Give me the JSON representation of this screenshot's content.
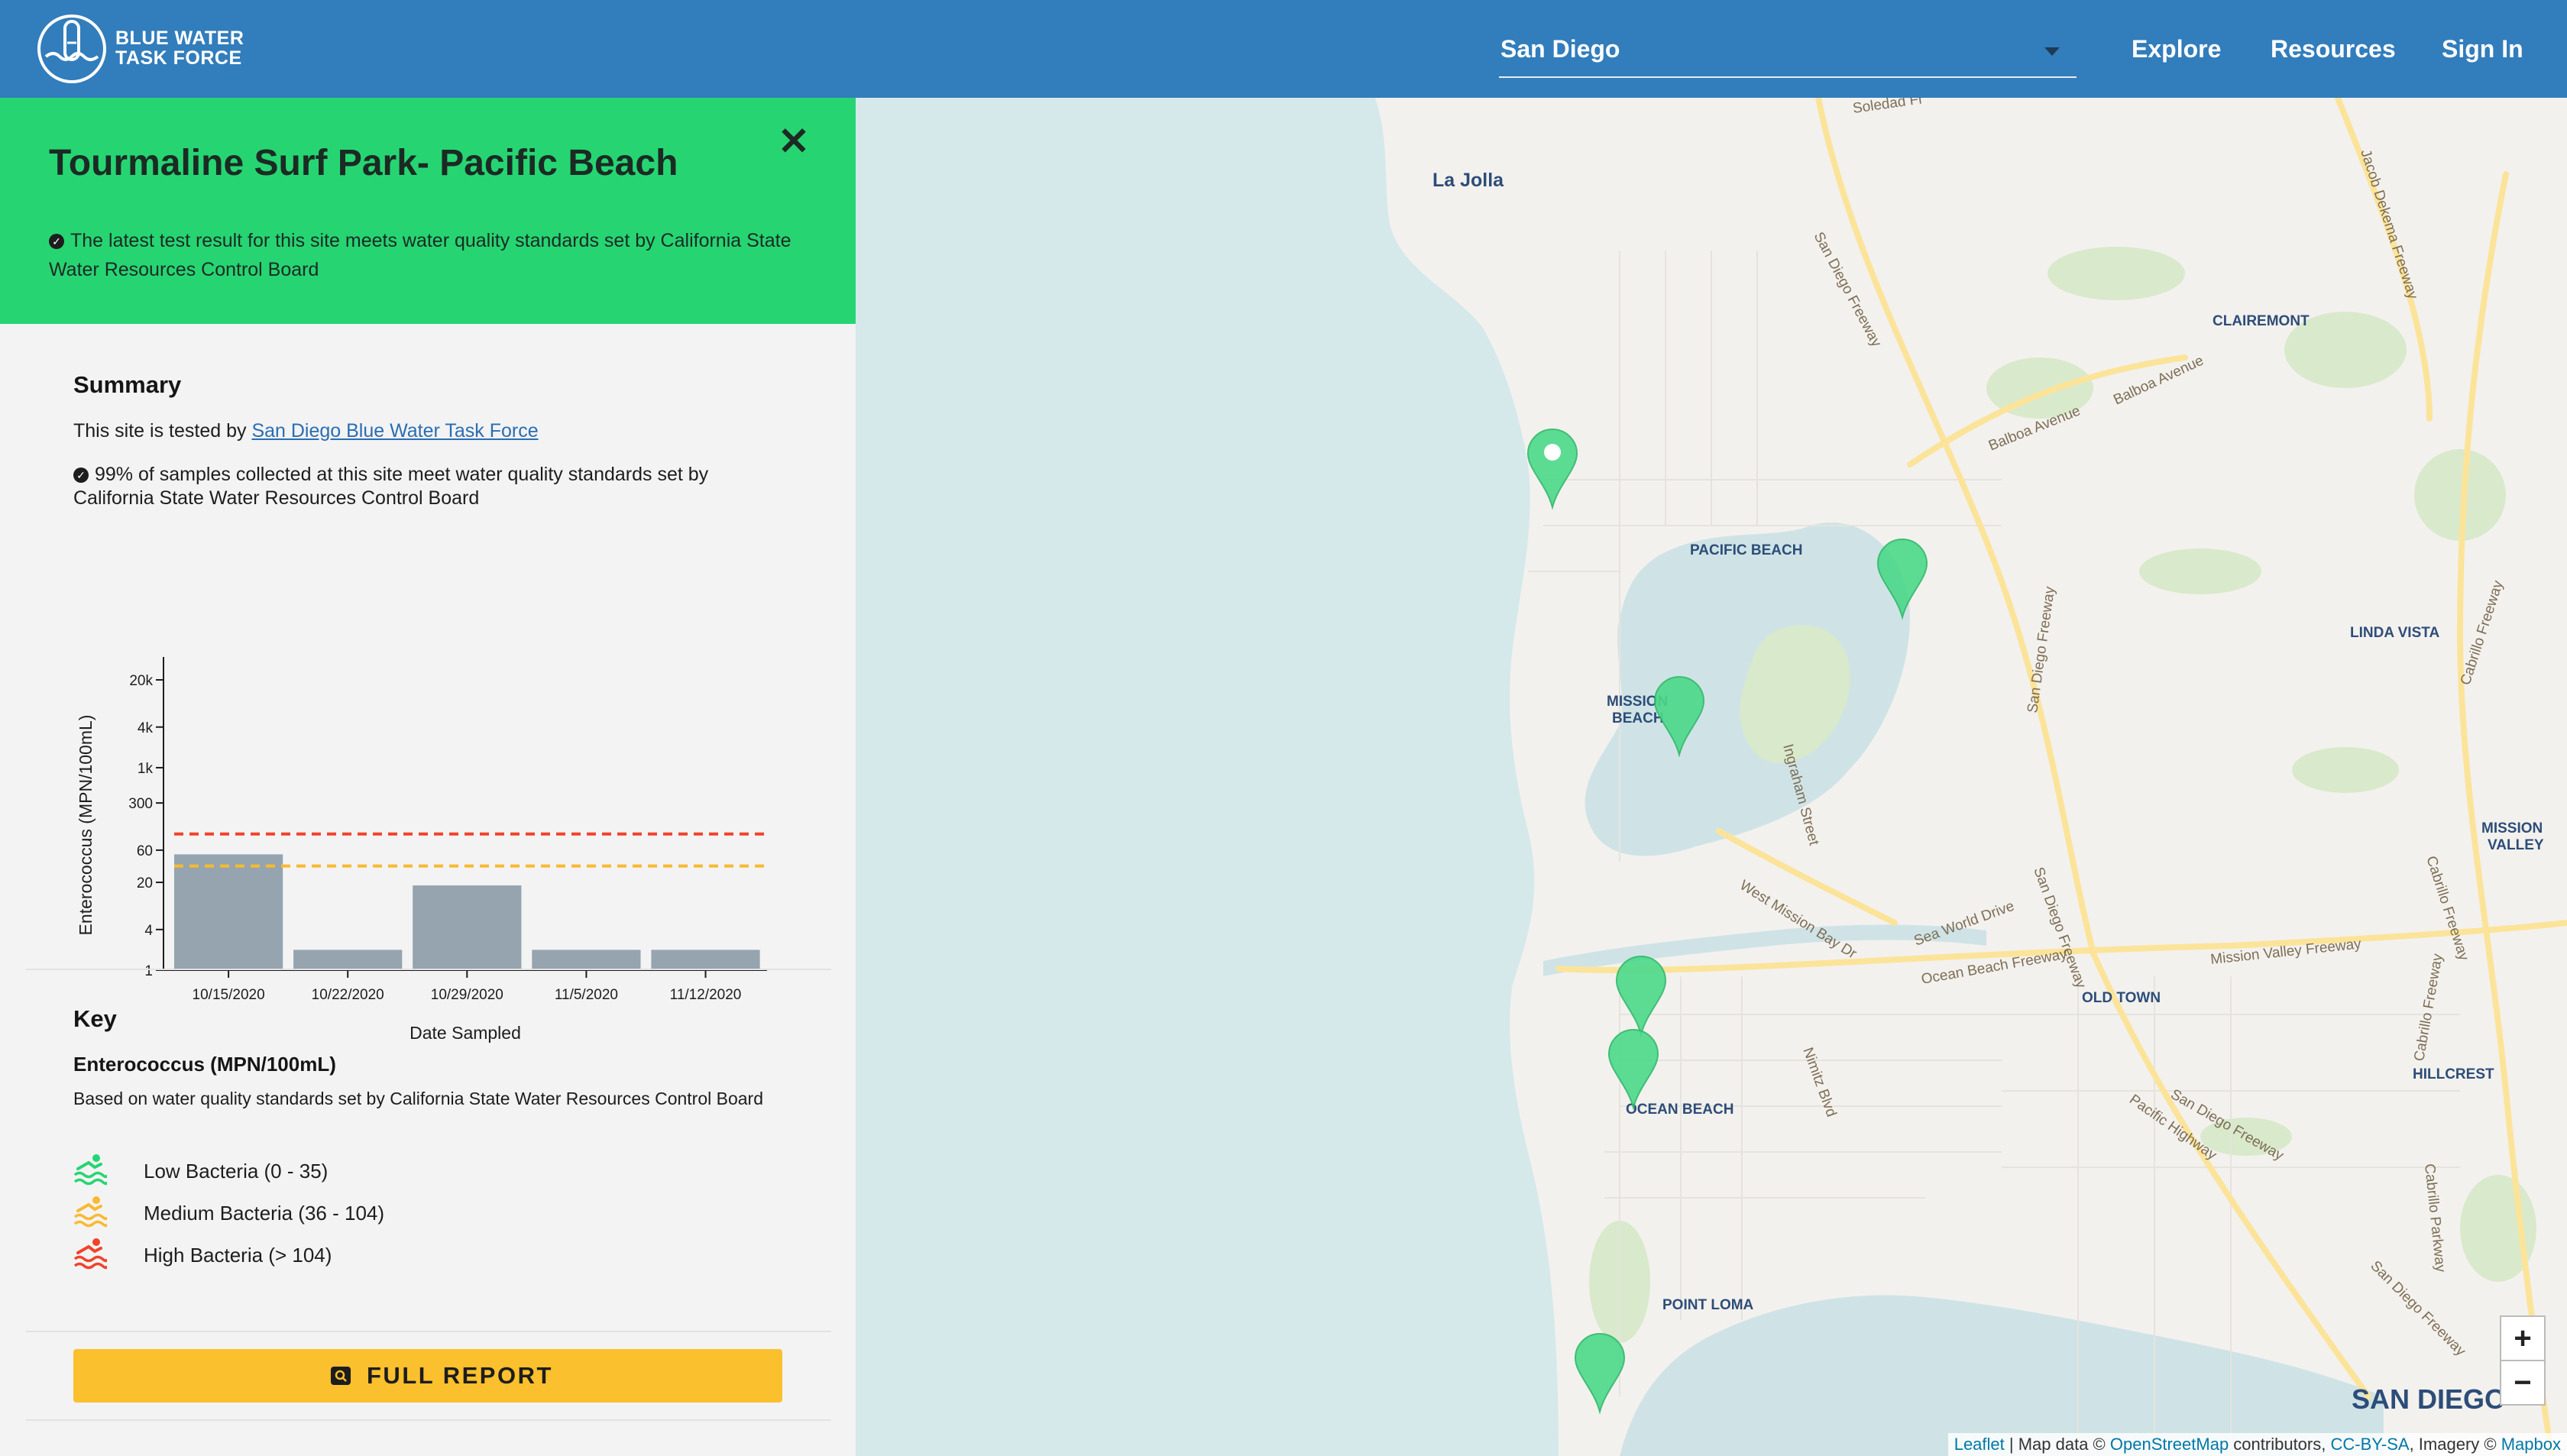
{
  "header": {
    "brand_line1": "BLUE WATER",
    "brand_line2": "TASK FORCE",
    "city_value": "San Diego",
    "nav": [
      "Explore",
      "Resources",
      "Sign In"
    ],
    "color": "#327dbc"
  },
  "site": {
    "title": "Tourmaline Surf Park- Pacific Beach",
    "status": "The latest test result for this site meets water quality standards set by California State Water Resources Control Board",
    "status_color": "#26d572"
  },
  "summary": {
    "title": "Summary",
    "tested_by_prefix": "This site is tested by ",
    "tested_by_link": "San Diego Blue Water Task Force",
    "percent_text": "99% of samples collected at this site meet water quality standards set by California State Water Resources Control Board"
  },
  "chart_data": {
    "type": "bar",
    "xlabel": "Date Sampled",
    "ylabel": "Enterococcus (MPN/100mL)",
    "yscale": "log",
    "y_ticks": [
      "1",
      "4",
      "20",
      "60",
      "300",
      "1k",
      "4k",
      "20k"
    ],
    "y_tick_values": [
      1,
      4,
      20,
      60,
      300,
      1000,
      4000,
      20000
    ],
    "categories": [
      "10/15/2020",
      "10/22/2020",
      "10/29/2020",
      "11/5/2020",
      "11/12/2020"
    ],
    "values": [
      52,
      2,
      18,
      2,
      2
    ],
    "thresholds": [
      {
        "value": 104,
        "color": "#f0432a",
        "style": "dashed"
      },
      {
        "value": 35,
        "color": "#f9b931",
        "style": "dashed"
      }
    ],
    "bar_color": "#95a4af"
  },
  "key": {
    "title": "Key",
    "subtitle": "Enterococcus (MPN/100mL)",
    "description": "Based on water quality standards set by California State Water Resources Control Board",
    "items": [
      {
        "label": "Low Bacteria (0 - 35)",
        "color": "#26d572",
        "icon": "swimmer-icon"
      },
      {
        "label": "Medium Bacteria (36 - 104)",
        "color": "#f9b931",
        "icon": "swimmer-icon"
      },
      {
        "label": "High Bacteria (> 104)",
        "color": "#f0432a",
        "icon": "swimmer-icon"
      }
    ]
  },
  "full_report_label": "FULL REPORT",
  "map": {
    "places": [
      "La Jolla",
      "CLAIREMONT",
      "PACIFIC BEACH",
      "MISSION",
      "BEACH",
      "LINDA VISTA",
      "MISSION",
      "VALLEY",
      "OLD TOWN",
      "OCEAN BEACH",
      "HILLCREST",
      "POINT LOMA",
      "SAN DIEGO"
    ],
    "roads": [
      "Soledad Fr",
      "San Diego Freeway",
      "Balboa Avenue",
      "Balboa Avenue",
      "Cabrillo Freeway",
      "Ingraham Street",
      "San Diego Freeway",
      "West Mission Bay Dr",
      "Sea World Drive",
      "Ocean Beach Freeway",
      "Mission Valley Freeway",
      "Nimitz Blvd",
      "Pacific Highway",
      "San Diego Freeway",
      "Cabrillo Freeway",
      "Cabrillo Parkway",
      "San Diego Freeway",
      "Jacob Dekema Freeway",
      "San Diego Freeway",
      "Cabrillo Freeway"
    ],
    "zoom_in": "+",
    "zoom_out": "−",
    "attribution": {
      "leaflet": "Leaflet",
      "sep1": " | Map data © ",
      "osm": "OpenStreetMap",
      "sep2": " contributors, ",
      "ccbysa": "CC-BY-SA",
      "sep3": ", Imagery © ",
      "mapbox": "Mapbox"
    },
    "marker_color": "#4cd98a"
  }
}
